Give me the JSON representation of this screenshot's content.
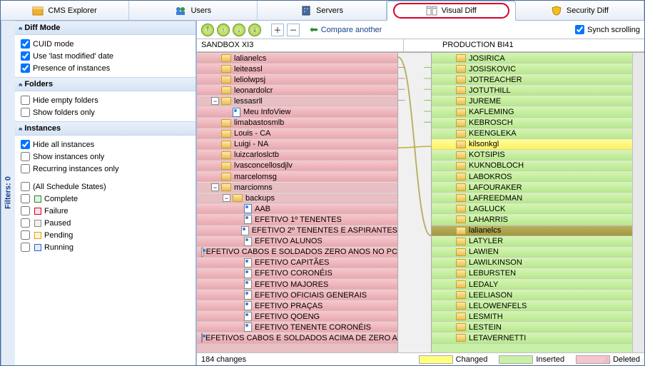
{
  "tabs": [
    "CMS Explorer",
    "Users",
    "Servers",
    "Visual Diff",
    "Security Diff"
  ],
  "activeTab": 3,
  "sidebar_label": "Filters: 0",
  "sections": {
    "diffmode": {
      "title": "Diff Mode",
      "items": [
        "CUID mode",
        "Use 'last modified' date",
        "Presence of instances"
      ],
      "checked": [
        true,
        true,
        true
      ]
    },
    "folders": {
      "title": "Folders",
      "items": [
        "Hide empty folders",
        "Show folders only"
      ],
      "checked": [
        false,
        false
      ]
    },
    "instances": {
      "title": "Instances",
      "items": [
        "Hide all instances",
        "Show instances only",
        "Recurring instances only"
      ],
      "checked": [
        true,
        false,
        false
      ]
    },
    "states": {
      "title": "(All Schedule States)",
      "items": [
        "Complete",
        "Failure",
        "Paused",
        "Pending",
        "Running"
      ],
      "colors": [
        "#2a8a2a",
        "#d4002a",
        "#888888",
        "#e0a000",
        "#2a60d0"
      ]
    }
  },
  "toolbar": {
    "compare": "Compare another",
    "synch": "Synch scrolling",
    "synch_checked": true
  },
  "left_title": "SANDBOX XI3",
  "right_title": "PRODUCTION BI41",
  "status": "184 changes",
  "legend": {
    "changed": "Changed",
    "inserted": "Inserted",
    "deleted": "Deleted",
    "c_changed": "#ffff80",
    "c_inserted": "#c8f0a8",
    "c_deleted": "#f5c6cb"
  },
  "left_rows": [
    {
      "d": 1,
      "t": "folder",
      "cls": "deleted",
      "label": "lalianelcs"
    },
    {
      "d": 1,
      "t": "folder",
      "cls": "deleted",
      "label": "leiteassl"
    },
    {
      "d": 1,
      "t": "folder",
      "cls": "deleted",
      "label": "leliolwpsj"
    },
    {
      "d": 1,
      "t": "folder",
      "cls": "deleted",
      "label": "leonardolcr"
    },
    {
      "d": 1,
      "t": "folder",
      "cls": "",
      "exp": "-",
      "label": "lessasrll"
    },
    {
      "d": 2,
      "t": "app",
      "cls": "deleted",
      "label": "Meu InfoView"
    },
    {
      "d": 1,
      "t": "folder",
      "cls": "deleted",
      "label": "limabastosmlb"
    },
    {
      "d": 1,
      "t": "folder",
      "cls": "deleted",
      "label": "Louis - CA"
    },
    {
      "d": 1,
      "t": "folder",
      "cls": "deleted",
      "label": "Luigi - NA"
    },
    {
      "d": 1,
      "t": "folder",
      "cls": "deleted",
      "label": "luizcarloslctb"
    },
    {
      "d": 1,
      "t": "folder",
      "cls": "deleted",
      "label": "lvasconcellosdjlv"
    },
    {
      "d": 1,
      "t": "folder",
      "cls": "deleted",
      "label": "marcelomsg"
    },
    {
      "d": 1,
      "t": "folder",
      "cls": "",
      "exp": "-",
      "label": "marciomns"
    },
    {
      "d": 2,
      "t": "folder",
      "cls": "",
      "exp": "-",
      "label": "backups"
    },
    {
      "d": 3,
      "t": "app",
      "cls": "deleted",
      "label": "AAB"
    },
    {
      "d": 3,
      "t": "doc",
      "cls": "deleted",
      "label": "EFETIVO 1º TENENTES"
    },
    {
      "d": 3,
      "t": "doc",
      "cls": "deleted",
      "label": "EFETIVO 2º TENENTES E ASPIRANTES"
    },
    {
      "d": 3,
      "t": "doc",
      "cls": "deleted",
      "label": "EFETIVO ALUNOS"
    },
    {
      "d": 3,
      "t": "doc",
      "cls": "deleted",
      "label": "EFETIVO CABOS E SOLDADOS ZERO ANOS NO PC"
    },
    {
      "d": 3,
      "t": "doc",
      "cls": "deleted",
      "label": "EFETIVO CAPITÃES"
    },
    {
      "d": 3,
      "t": "doc",
      "cls": "deleted",
      "label": "EFETIVO CORONÉIS"
    },
    {
      "d": 3,
      "t": "doc",
      "cls": "deleted",
      "label": "EFETIVO MAJORES"
    },
    {
      "d": 3,
      "t": "doc",
      "cls": "deleted",
      "label": "EFETIVO OFICIAIS GENERAIS"
    },
    {
      "d": 3,
      "t": "doc",
      "cls": "deleted",
      "label": "EFETIVO PRAÇAS"
    },
    {
      "d": 3,
      "t": "doc",
      "cls": "deleted",
      "label": "EFETIVO QOENG"
    },
    {
      "d": 3,
      "t": "doc",
      "cls": "deleted",
      "label": "EFETIVO TENENTE CORONÉIS"
    },
    {
      "d": 3,
      "t": "doc",
      "cls": "deleted",
      "label": "EFETIVOS CABOS E SOLDADOS ACIMA DE ZERO A"
    }
  ],
  "right_rows": [
    {
      "d": 1,
      "t": "folder",
      "cls": "inserted",
      "label": "JOSIRICA"
    },
    {
      "d": 1,
      "t": "folder",
      "cls": "inserted",
      "label": "JOSISKOVIC"
    },
    {
      "d": 1,
      "t": "folder",
      "cls": "inserted",
      "label": "JOTREACHER"
    },
    {
      "d": 1,
      "t": "folder",
      "cls": "inserted",
      "label": "JOTUTHILL"
    },
    {
      "d": 1,
      "t": "folder",
      "cls": "inserted",
      "label": "JUREME"
    },
    {
      "d": 1,
      "t": "folder",
      "cls": "inserted",
      "label": "KAFLEMING"
    },
    {
      "d": 1,
      "t": "folder",
      "cls": "inserted",
      "label": "KEBROSCH"
    },
    {
      "d": 1,
      "t": "folder",
      "cls": "inserted",
      "label": "KEENGLEKA"
    },
    {
      "d": 1,
      "t": "folder",
      "cls": "changed",
      "label": "kilsonkgl"
    },
    {
      "d": 1,
      "t": "folder",
      "cls": "inserted",
      "label": "KOTSIPIS"
    },
    {
      "d": 1,
      "t": "folder",
      "cls": "inserted",
      "label": "KUKNOBLOCH"
    },
    {
      "d": 1,
      "t": "folder",
      "cls": "inserted",
      "label": "LABOKROS"
    },
    {
      "d": 1,
      "t": "folder",
      "cls": "inserted",
      "label": "LAFOURAKER"
    },
    {
      "d": 1,
      "t": "folder",
      "cls": "inserted",
      "label": "LAFREEDMAN"
    },
    {
      "d": 1,
      "t": "folder",
      "cls": "inserted",
      "label": "LAGLUCK"
    },
    {
      "d": 1,
      "t": "folder",
      "cls": "inserted",
      "label": "LAHARRIS"
    },
    {
      "d": 1,
      "t": "folder",
      "cls": "selected",
      "label": "lalianelcs"
    },
    {
      "d": 1,
      "t": "folder",
      "cls": "inserted",
      "label": "LATYLER"
    },
    {
      "d": 1,
      "t": "folder",
      "cls": "inserted",
      "label": "LAWIEN"
    },
    {
      "d": 1,
      "t": "folder",
      "cls": "inserted",
      "label": "LAWILKINSON"
    },
    {
      "d": 1,
      "t": "folder",
      "cls": "inserted",
      "label": "LEBURSTEN"
    },
    {
      "d": 1,
      "t": "folder",
      "cls": "inserted",
      "label": "LEDALY"
    },
    {
      "d": 1,
      "t": "folder",
      "cls": "inserted",
      "label": "LEELIASON"
    },
    {
      "d": 1,
      "t": "folder",
      "cls": "inserted",
      "label": "LELOWENFELS"
    },
    {
      "d": 1,
      "t": "folder",
      "cls": "inserted",
      "label": "LESMITH"
    },
    {
      "d": 1,
      "t": "folder",
      "cls": "inserted",
      "label": "LESTEIN"
    },
    {
      "d": 1,
      "t": "folder",
      "cls": "inserted",
      "label": "LETAVERNETTI"
    }
  ]
}
